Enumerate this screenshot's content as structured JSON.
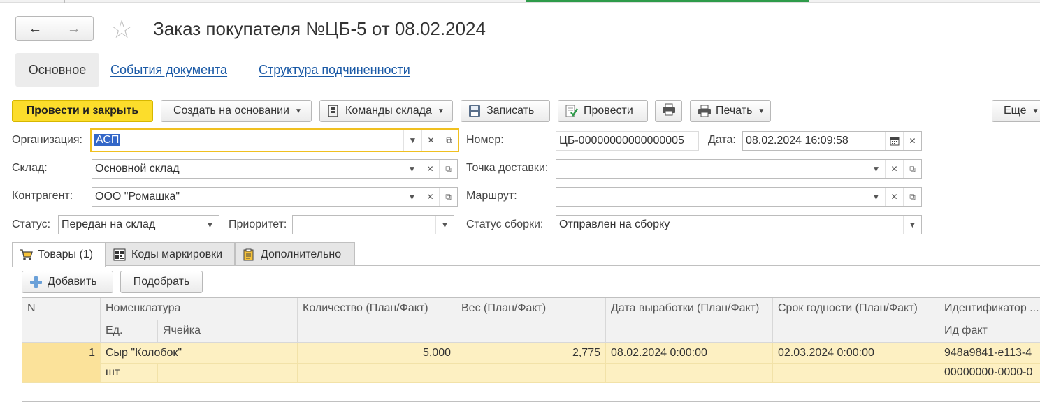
{
  "window": {
    "title": "Заказ покупателя №ЦБ-5 от 08.02.2024"
  },
  "nav": {
    "back_icon": "←",
    "forward_icon": "→",
    "favorite_icon": "☆"
  },
  "page_tabs": {
    "main": "Основное",
    "events": "События документа",
    "structure": "Структура подчиненности"
  },
  "toolbar": {
    "post_close": "Провести и закрыть",
    "create_based": "Создать на основании",
    "warehouse_cmds": "Команды склада",
    "save": "Записать",
    "post": "Провести",
    "print": "Печать",
    "more": "Еще"
  },
  "form": {
    "org_label": "Организация:",
    "org_value": "АСП",
    "warehouse_label": "Склад:",
    "warehouse_value": "Основной склад",
    "counterparty_label": "Контрагент:",
    "counterparty_value": "ООО \"Ромашка\"",
    "status_label": "Статус:",
    "status_value": "Передан на склад",
    "priority_label": "Приоритет:",
    "priority_value": "",
    "number_label": "Номер:",
    "number_value": "ЦБ-00000000000000005",
    "date_label": "Дата:",
    "date_value": "08.02.2024 16:09:58",
    "delivery_label": "Точка доставки:",
    "delivery_value": "",
    "route_label": "Маршрут:",
    "route_value": "",
    "assembly_label": "Статус сборки:",
    "assembly_value": "Отправлен на сборку"
  },
  "doc_tabs": {
    "goods": "Товары (1)",
    "marks": "Коды маркировки",
    "extra": "Дополнительно"
  },
  "table_toolbar": {
    "add": "Добавить",
    "pick": "Подобрать"
  },
  "table": {
    "headers": {
      "n": "N",
      "item": "Номенклатура",
      "unit": "Ед.",
      "cell": "Ячейка",
      "qty": "Количество (План/Факт)",
      "weight": "Вес (План/Факт)",
      "prod_date": "Дата выработки (План/Факт)",
      "expiry": "Срок годности (План/Факт)",
      "ident": "Идентификатор ...",
      "ident_fact": "Ид факт"
    },
    "rows": [
      {
        "n": "1",
        "item": "Сыр \"Колобок\"",
        "unit": "шт",
        "cell": "",
        "qty": "5,000",
        "weight": "2,775",
        "prod_date": "08.02.2024 0:00:00",
        "expiry": "02.03.2024 0:00:00",
        "ident": "948a9841-e113-4",
        "ident_fact": "00000000-0000-0"
      }
    ]
  },
  "colors": {
    "primary_button": "#fcdd2b",
    "link": "#1b5aa6",
    "row_highlight": "#fdf0c2",
    "focus_border": "#f0c020"
  }
}
